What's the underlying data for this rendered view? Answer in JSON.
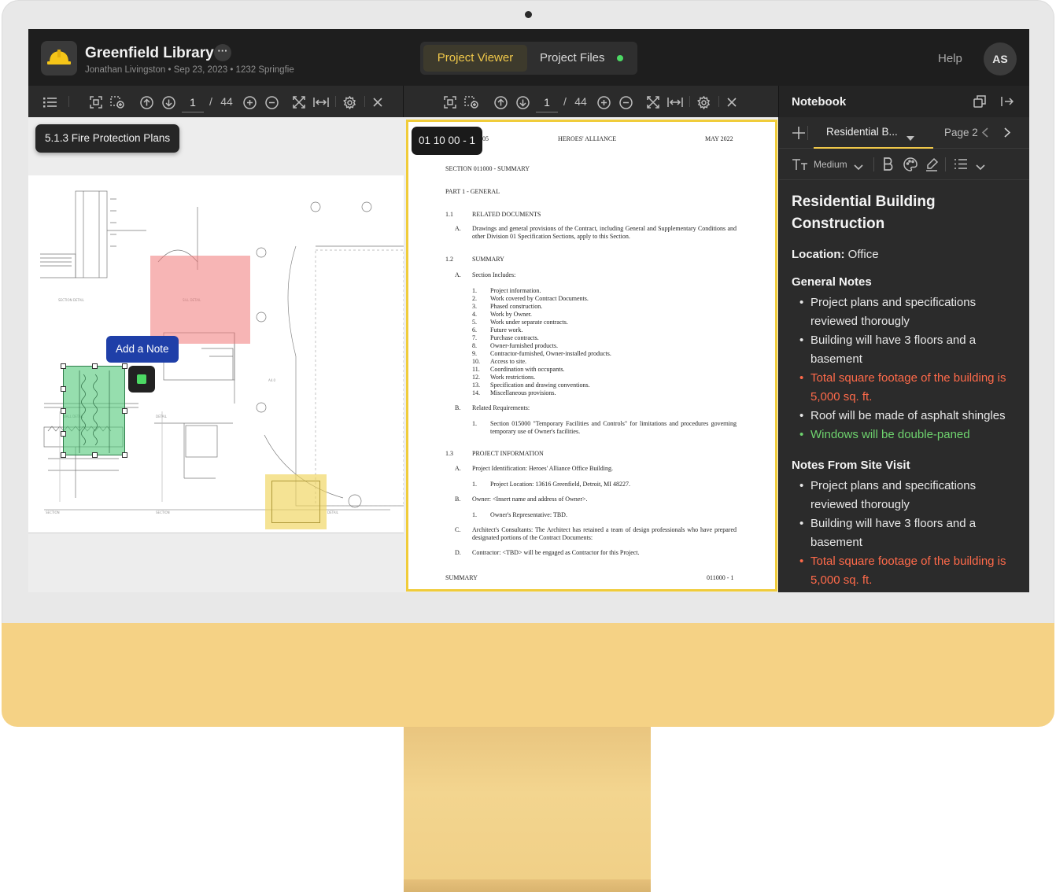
{
  "header": {
    "project_title": "Greenfield Library",
    "more_label": "···",
    "subtitle": "Jonathan Livingston • Sep 23, 2023 • 1232 Springfie",
    "tabs": [
      {
        "label": "Project Viewer",
        "active": true
      },
      {
        "label": "Project Files",
        "active": false
      }
    ],
    "help_label": "Help",
    "avatar_initials": "AS"
  },
  "left_viewer": {
    "page_current": "1",
    "page_sep": "/",
    "page_total": "44",
    "doc_tag": "5.1.3 Fire Protection Plans",
    "add_note_label": "Add a Note"
  },
  "mid_viewer": {
    "page_current": "1",
    "page_sep": "/",
    "page_total": "44",
    "doc_tag": "01 10 00 - 1",
    "doc": {
      "header_left": ".02.05",
      "header_center": "HEROES' ALLIANCE",
      "header_right": "MAY 2022",
      "section_title": "SECTION 011000 - SUMMARY",
      "part1": "PART 1 - GENERAL",
      "s11_num": "1.1",
      "s11_title": "RELATED DOCUMENTS",
      "s11a_letter": "A.",
      "s11a_text": "Drawings and general provisions of the Contract, including General and Supplementary Conditions and other Division 01 Specification Sections, apply to this Section.",
      "s12_num": "1.2",
      "s12_title": "SUMMARY",
      "s12a_letter": "A.",
      "s12a_text": "Section Includes:",
      "includes": [
        "Project information.",
        "Work covered by Contract Documents.",
        "Phased construction.",
        "Work by Owner.",
        "Work under separate contracts.",
        "Future work.",
        "Purchase contracts.",
        "Owner-furnished products.",
        "Contractor-furnished, Owner-installed products.",
        "Access to site.",
        "Coordination with occupants.",
        "Work restrictions.",
        "Specification and drawing conventions.",
        "Miscellaneous provisions."
      ],
      "s12b_letter": "B.",
      "s12b_text": "Related Requirements:",
      "s12b1_num": "1.",
      "s12b1_text": "Section 015000 \"Temporary Facilities and Controls\" for limitations and procedures governing temporary use of Owner's facilities.",
      "s13_num": "1.3",
      "s13_title": "PROJECT INFORMATION",
      "s13a_letter": "A.",
      "s13a_text": "Project Identification: Heroes' Alliance Office Building.",
      "s13a1_num": "1.",
      "s13a1_text": "Project Location: 13616 Greenfield, Detroit, MI 48227.",
      "s13b_letter": "B.",
      "s13b_text": "Owner: <Insert name and address of Owner>.",
      "s13b1_num": "1.",
      "s13b1_text": "Owner's Representative: TBD.",
      "s13c_letter": "C.",
      "s13c_text": "Architect's Consultants: The Architect has retained a team of design professionals who have prepared designated portions of the Contract Documents:",
      "s13d_letter": "D.",
      "s13d_text": "Contractor: <TBD> will be engaged as Contractor for this Project.",
      "footer_left": "SUMMARY",
      "footer_right": "011000 - 1"
    }
  },
  "notebook": {
    "title": "Notebook",
    "tab_label": "Residential B...",
    "page_label": "Page 2",
    "text_size": "Medium",
    "note_title": "Residential Building Construction",
    "location_label": "Location:",
    "location_value": "Office",
    "general_heading": "General Notes",
    "general_notes": [
      {
        "text": "Project plans and specifications reviewed thorougly",
        "color": "default"
      },
      {
        "text": "Building will have 3 floors and a basement",
        "color": "default"
      },
      {
        "text": "Total square footage of the building is 5,000 sq. ft.",
        "color": "#ff6a4a"
      },
      {
        "text": "Roof will be made of asphalt shingles",
        "color": "default"
      },
      {
        "text": "Windows will be double-paned",
        "color": "#6ed36e"
      }
    ],
    "site_heading": "Notes From Site Visit",
    "site_notes": [
      {
        "text": "Project plans and specifications reviewed thorougly",
        "color": "default"
      },
      {
        "text": "Building will have 3 floors and a basement",
        "color": "default"
      },
      {
        "text": "Total square footage of the building is 5,000 sq. ft.",
        "color": "#ff6a4a"
      }
    ]
  },
  "colors": {
    "accent": "#f0c84a",
    "frame_yellow": "#f5d285",
    "add_note_blue": "#1f3fa8",
    "highlight_red": "#f07878",
    "highlight_green": "#50c878",
    "highlight_yellow": "#f0d45a"
  }
}
